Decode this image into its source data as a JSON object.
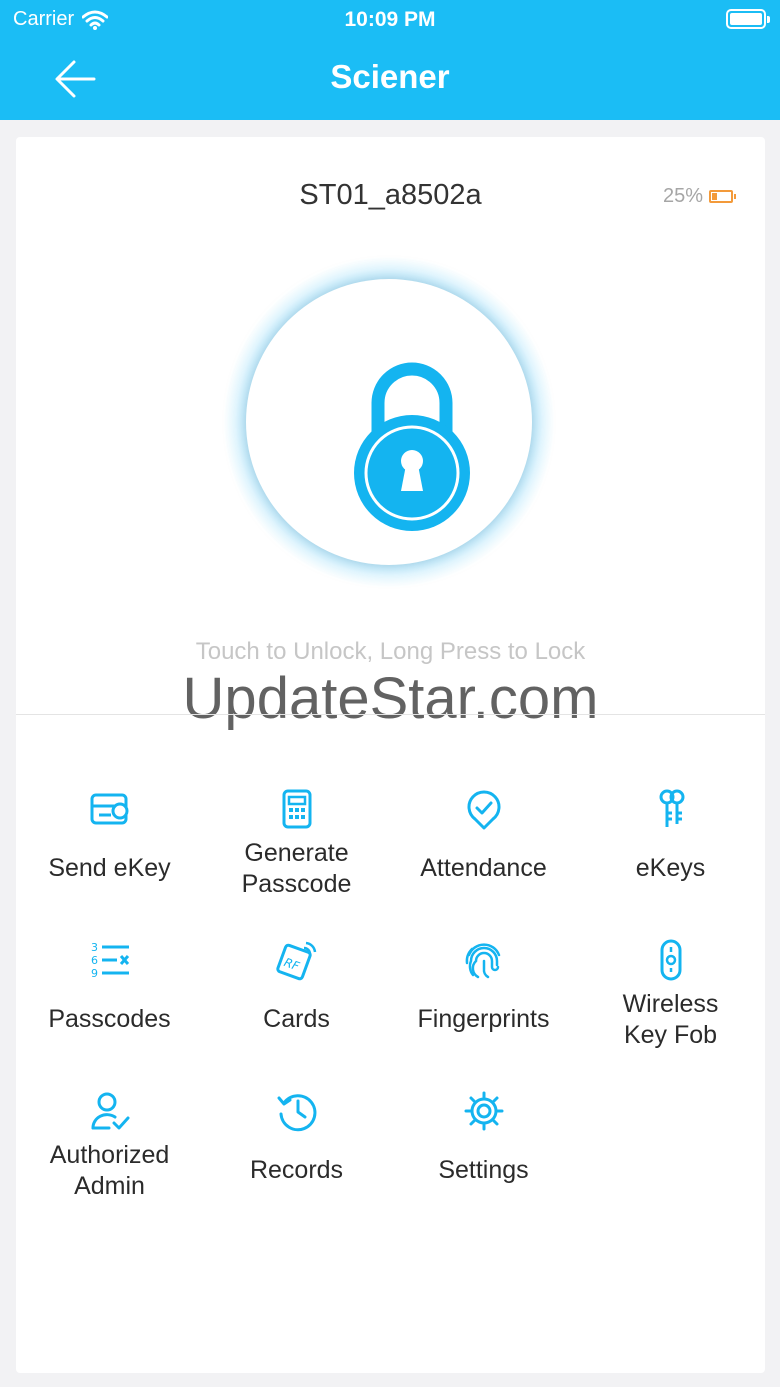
{
  "status_bar": {
    "carrier": "Carrier",
    "time": "10:09 PM"
  },
  "header": {
    "title": "Sciener"
  },
  "lock": {
    "name": "ST01_a8502a",
    "battery": "25%",
    "hint": "Touch to Unlock, Long Press to Lock"
  },
  "watermark": "UpdateStar.com",
  "menu": {
    "send_ekey": "Send eKey",
    "generate_passcode_1": "Generate",
    "generate_passcode_2": "Passcode",
    "attendance": "Attendance",
    "ekeys": "eKeys",
    "passcodes": "Passcodes",
    "cards": "Cards",
    "fingerprints": "Fingerprints",
    "wireless_key_fob_1": "Wireless",
    "wireless_key_fob_2": "Key Fob",
    "authorized_admin_1": "Authorized",
    "authorized_admin_2": "Admin",
    "records": "Records",
    "settings": "Settings"
  },
  "colors": {
    "accent": "#1bbdf5",
    "battery_low": "#f39a3a"
  }
}
